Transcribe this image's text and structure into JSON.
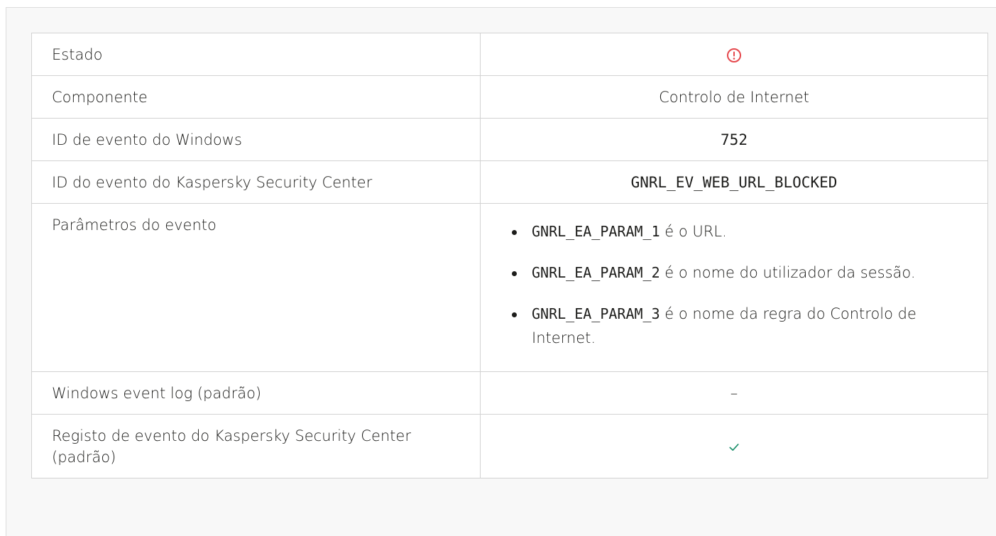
{
  "table": {
    "rows": [
      {
        "label": "Estado",
        "value_type": "icon",
        "icon": "error-circle-icon",
        "icon_color": "#e5484d"
      },
      {
        "label": "Componente",
        "value": "Controlo de Internet"
      },
      {
        "label": "ID de evento do Windows",
        "value": "752"
      },
      {
        "label": "ID do evento do Kaspersky Security Center",
        "value": "GNRL_EV_WEB_URL_BLOCKED"
      },
      {
        "label": "Parâmetros do evento"
      },
      {
        "label": "Windows event log (padrão)",
        "value": "–"
      },
      {
        "label": "Registo de evento do Kaspersky Security Center (padrão)",
        "value_type": "icon",
        "icon": "check-icon",
        "icon_color": "#1a8f6a"
      }
    ],
    "params": [
      {
        "code": "GNRL_EA_PARAM_1",
        "text": " é o URL."
      },
      {
        "code": "GNRL_EA_PARAM_2",
        "text": " é o nome do utilizador da sessão."
      },
      {
        "code": "GNRL_EA_PARAM_3",
        "text": " é o nome da regra do Controlo de Internet."
      }
    ]
  }
}
